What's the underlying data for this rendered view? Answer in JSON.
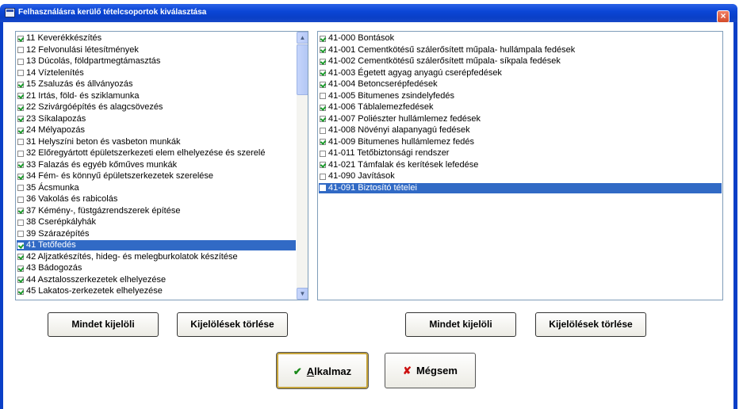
{
  "window": {
    "title": "Felhasználásra kerülő tételcsoportok kiválasztása",
    "close_label": "×"
  },
  "left_list": {
    "items": [
      {
        "label": "11 Keverékkészítés",
        "checked": true,
        "selected": false
      },
      {
        "label": "12 Felvonulási létesítmények",
        "checked": false,
        "selected": false
      },
      {
        "label": "13 Dúcolás, földpartmegtámasztás",
        "checked": false,
        "selected": false
      },
      {
        "label": "14 Víztelenítés",
        "checked": false,
        "selected": false
      },
      {
        "label": "15 Zsaluzás és állványozás",
        "checked": true,
        "selected": false
      },
      {
        "label": "21 Irtás, föld- és sziklamunka",
        "checked": true,
        "selected": false
      },
      {
        "label": "22 Szivárgóépítés és alagcsövezés",
        "checked": true,
        "selected": false
      },
      {
        "label": "23 Síkalapozás",
        "checked": true,
        "selected": false
      },
      {
        "label": "24 Mélyapozás",
        "checked": true,
        "selected": false
      },
      {
        "label": "31 Helyszíni beton és vasbeton munkák",
        "checked": false,
        "selected": false
      },
      {
        "label": "32 Előregyártott épületszerkezeti elem elhelyezése és szerelé",
        "checked": false,
        "selected": false
      },
      {
        "label": "33 Falazás és egyéb kőműves munkák",
        "checked": true,
        "selected": false
      },
      {
        "label": "34 Fém- és könnyű épületszerkezetek szerelése",
        "checked": true,
        "selected": false
      },
      {
        "label": "35 Ácsmunka",
        "checked": false,
        "selected": false
      },
      {
        "label": "36 Vakolás és rabicolás",
        "checked": false,
        "selected": false
      },
      {
        "label": "37 Kémény-, füstgázrendszerek építése",
        "checked": true,
        "selected": false
      },
      {
        "label": "38 Cserépkályhák",
        "checked": false,
        "selected": false
      },
      {
        "label": "39 Szárazépítés",
        "checked": false,
        "selected": false
      },
      {
        "label": "41 Tetőfedés",
        "checked": true,
        "selected": true
      },
      {
        "label": "42 Aljzatkészítés, hideg- és melegburkolatok készítése",
        "checked": true,
        "selected": false
      },
      {
        "label": "43 Bádogozás",
        "checked": true,
        "selected": false
      },
      {
        "label": "44 Asztalosszerkezetek elhelyezése",
        "checked": true,
        "selected": false
      },
      {
        "label": "45 Lakatos-zerkezetek elhelyezése",
        "checked": true,
        "selected": false
      }
    ],
    "scroll_up": "▲",
    "scroll_down": "▼"
  },
  "right_list": {
    "items": [
      {
        "label": "41-000 Bontások",
        "checked": true,
        "selected": false
      },
      {
        "label": "41-001 Cementkötésű szálerősített műpala- hullámpala fedések",
        "checked": true,
        "selected": false
      },
      {
        "label": "41-002 Cementkötésű szálerősített műpala- síkpala fedések",
        "checked": true,
        "selected": false
      },
      {
        "label": "41-003 Égetett agyag anyagú cserépfedések",
        "checked": true,
        "selected": false
      },
      {
        "label": "41-004 Betoncserépfedések",
        "checked": true,
        "selected": false
      },
      {
        "label": "41-005 Bitumenes zsindelyfedés",
        "checked": false,
        "selected": false
      },
      {
        "label": "41-006 Táblalemezfedések",
        "checked": true,
        "selected": false
      },
      {
        "label": "41-007 Poliészter hullámlemez fedések",
        "checked": true,
        "selected": false
      },
      {
        "label": "41-008 Növényi alapanyagú fedések",
        "checked": false,
        "selected": false
      },
      {
        "label": "41-009 Bitumenes hullámlemez fedés",
        "checked": true,
        "selected": false
      },
      {
        "label": "41-011 Tetőbiztonsági rendszer",
        "checked": false,
        "selected": false
      },
      {
        "label": "41-021 Támfalak és kerítések lefedése",
        "checked": true,
        "selected": false
      },
      {
        "label": "41-090 Javítások",
        "checked": false,
        "selected": false
      },
      {
        "label": "41-091 Biztosító tételei",
        "checked": false,
        "selected": true
      }
    ]
  },
  "buttons": {
    "left_select_all": "Mindet kijelöli",
    "left_clear": "Kijelölések törlése",
    "right_select_all": "Mindet kijelöli",
    "right_clear": "Kijelölések törlése",
    "apply_check": "✔",
    "apply_label_first": "A",
    "apply_label_rest": "lkalmaz",
    "cancel_x": "✘",
    "cancel_label": "Mégsem"
  }
}
